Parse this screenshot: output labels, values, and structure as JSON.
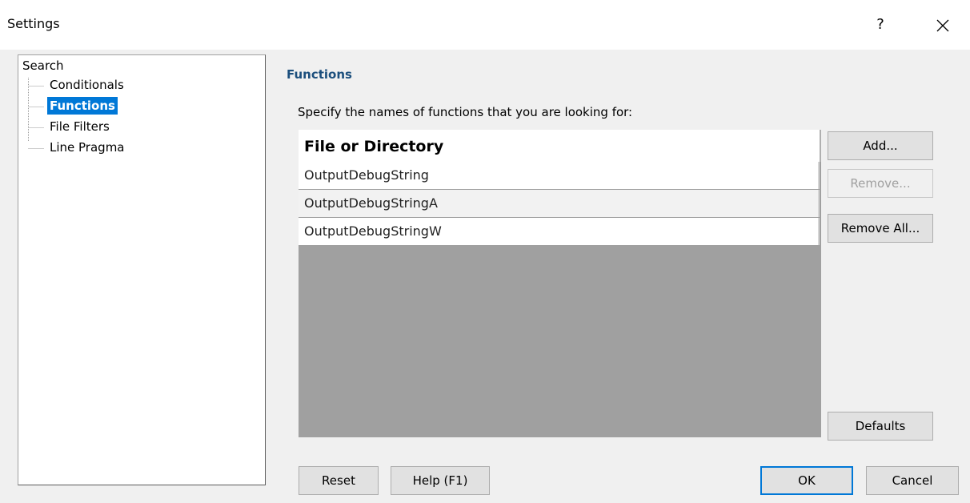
{
  "window": {
    "title": "Settings",
    "help_label": "?",
    "close_label": "✕"
  },
  "tree": {
    "root_label": "Search",
    "items": [
      {
        "label": "Conditionals",
        "selected": false
      },
      {
        "label": "Functions",
        "selected": true
      },
      {
        "label": "File Filters",
        "selected": false
      },
      {
        "label": "Line Pragma",
        "selected": false
      }
    ]
  },
  "main": {
    "section_title": "Functions",
    "description": "Specify the names of functions that you are looking for:",
    "list": {
      "column_header": "File or Directory",
      "rows": [
        "OutputDebugString",
        "OutputDebugStringA",
        "OutputDebugStringW"
      ]
    }
  },
  "side_buttons": {
    "add": "Add...",
    "remove": "Remove...",
    "remove_all": "Remove All...",
    "defaults": "Defaults"
  },
  "footer": {
    "reset": "Reset",
    "help": "Help (F1)",
    "ok": "OK",
    "cancel": "Cancel"
  },
  "colors": {
    "accent": "#0078d7",
    "section_title": "#1c4f7d",
    "list_empty_area": "#a0a0a0"
  }
}
